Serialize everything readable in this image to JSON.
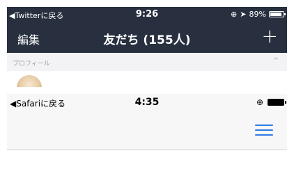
{
  "line_screen": {
    "status_bar": {
      "back_label": "◀Twitterに戻る",
      "time": "9:26",
      "battery": "89%",
      "battery_level": 0.89,
      "location_icon": "➤",
      "rotation_lock_icon": "⊕"
    },
    "navbar": {
      "edit_label": "編集",
      "title": "友だち (155人)",
      "add_label": "+"
    },
    "section": {
      "label": "プロフィール",
      "chevron": "^"
    }
  },
  "safari_screen": {
    "status_bar": {
      "back_label": "◀Safariに戻る",
      "time": "4:35",
      "rotation_lock_icon": "⊕"
    },
    "toolbar": {
      "menu_icon": "list-icon"
    }
  },
  "colors": {
    "line_header": "#283040",
    "accent_blue": "#2f7ae5"
  }
}
